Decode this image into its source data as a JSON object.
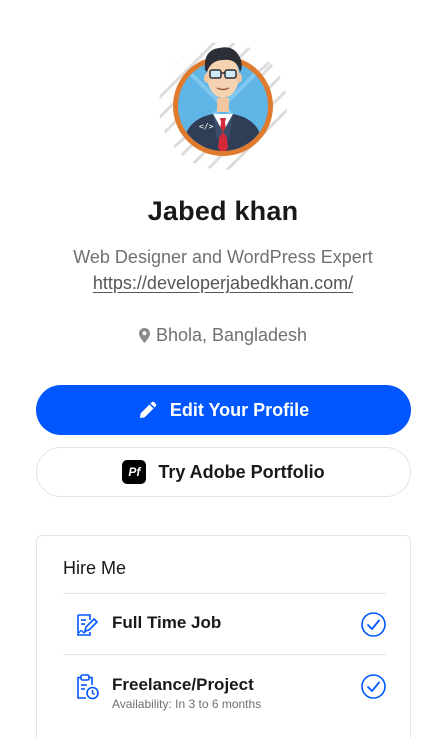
{
  "profile": {
    "name": "Jabed khan",
    "tagline": "Web Designer and WordPress Expert",
    "website": "https://developerjabedkhan.com/",
    "location": "Bhola, Bangladesh",
    "avatar_icon": "developer-avatar-illustration"
  },
  "actions": {
    "edit_label": "Edit Your Profile",
    "edit_icon": "pencil-icon",
    "portfolio_label": "Try Adobe Portfolio",
    "portfolio_badge": "Pf"
  },
  "hire": {
    "title": "Hire Me",
    "options": [
      {
        "label": "Full Time Job",
        "sub": "",
        "icon": "contract-pen-icon",
        "checked": true
      },
      {
        "label": "Freelance/Project",
        "sub": "Availability: In 3 to 6 months",
        "icon": "clipboard-clock-icon",
        "checked": true
      }
    ]
  },
  "colors": {
    "primary": "#0057ff",
    "accent_ring": "#e07a2c",
    "text_muted": "#707070"
  }
}
